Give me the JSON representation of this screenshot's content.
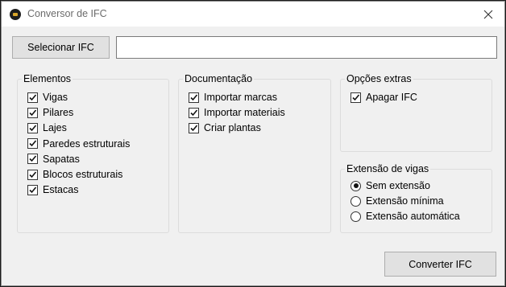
{
  "window": {
    "title": "Conversor de IFC",
    "icon": "app-logo-icon"
  },
  "toolbar": {
    "select_button": "Selecionar IFC",
    "path_value": ""
  },
  "elementos": {
    "label": "Elementos",
    "items": [
      {
        "label": "Vigas",
        "checked": true
      },
      {
        "label": "Pilares",
        "checked": true
      },
      {
        "label": "Lajes",
        "checked": true
      },
      {
        "label": "Paredes estruturais",
        "checked": true
      },
      {
        "label": "Sapatas",
        "checked": true
      },
      {
        "label": "Blocos estruturais",
        "checked": true
      },
      {
        "label": "Estacas",
        "checked": true
      }
    ]
  },
  "documentacao": {
    "label": "Documentação",
    "items": [
      {
        "label": "Importar marcas",
        "checked": true
      },
      {
        "label": "Importar materiais",
        "checked": true
      },
      {
        "label": "Criar plantas",
        "checked": true
      }
    ]
  },
  "opcoes_extras": {
    "label": "Opções extras",
    "items": [
      {
        "label": "Apagar IFC",
        "checked": true
      }
    ]
  },
  "extensao_vigas": {
    "label": "Extensão de vigas",
    "options": [
      {
        "label": "Sem extensão",
        "selected": true
      },
      {
        "label": "Extensão mínima",
        "selected": false
      },
      {
        "label": "Extensão automática",
        "selected": false
      }
    ]
  },
  "footer": {
    "convert_button": "Converter IFC"
  }
}
